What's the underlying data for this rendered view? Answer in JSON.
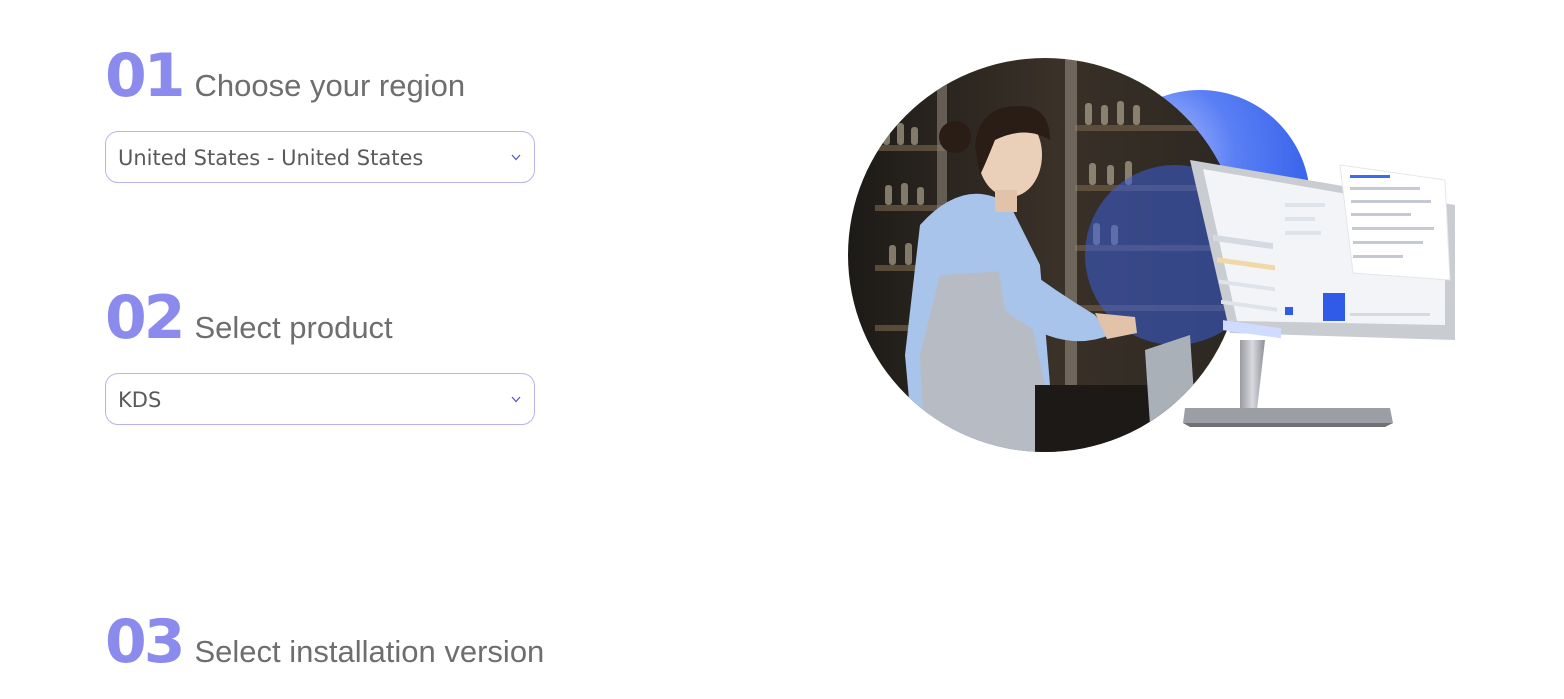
{
  "steps": [
    {
      "number": "01",
      "title": "Choose your region",
      "select_value": "United States - United States"
    },
    {
      "number": "02",
      "title": "Select product",
      "select_value": "KDS"
    },
    {
      "number": "03",
      "title": "Select installation version"
    }
  ],
  "colors": {
    "step_number": "#8b8bee",
    "select_border": "#b9b4f0",
    "chevron": "#5a5ad6",
    "accent_blue": "#3b6cf0"
  },
  "icons": {
    "dropdown": "chevron-down-icon"
  }
}
